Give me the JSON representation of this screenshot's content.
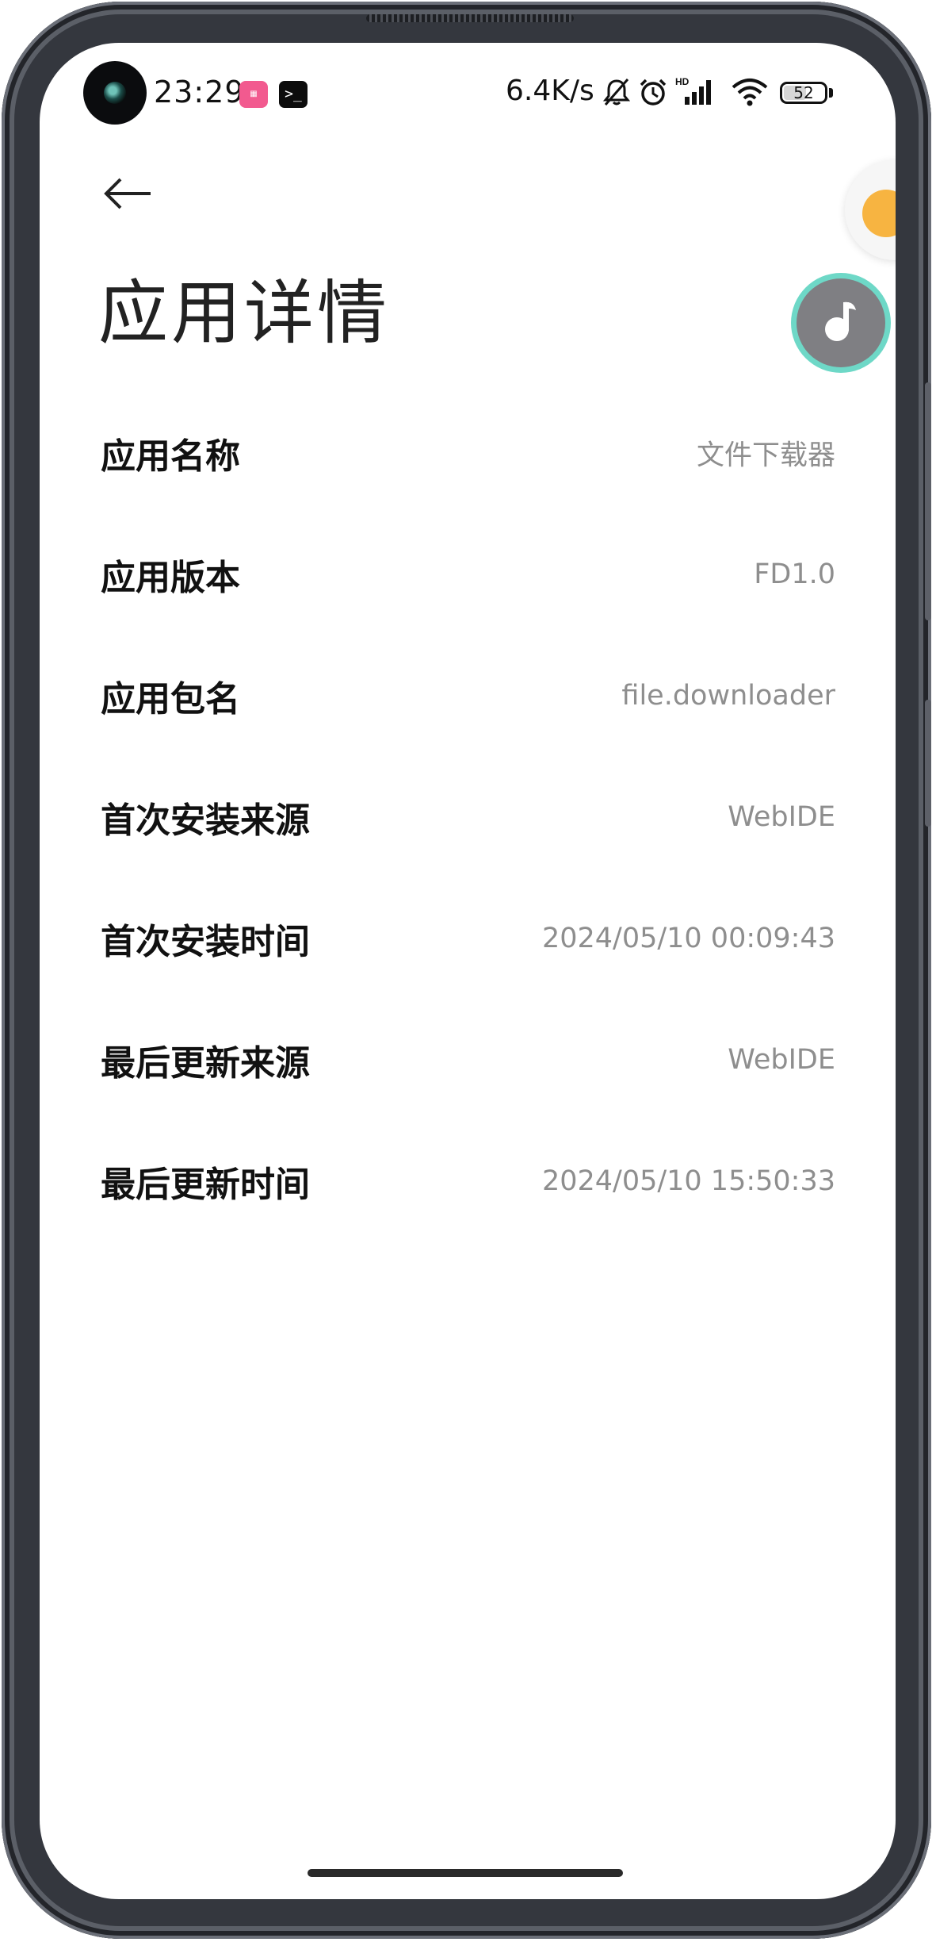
{
  "status_bar": {
    "time": "23:29",
    "net_speed": "6.4K/s",
    "battery": "52",
    "battery_level": 0.52,
    "icons": [
      "app-notification-icon",
      "terminal-icon",
      "mute-bell-icon",
      "alarm-icon",
      "hd-signal-icon",
      "wifi-icon",
      "battery-icon"
    ]
  },
  "header": {
    "back_icon": "back-arrow-icon",
    "title": "应用详情"
  },
  "floating": {
    "coin_icon": "coin-icon",
    "music_icon": "music-note-icon"
  },
  "details": [
    {
      "label": "应用名称",
      "value": "文件下载器"
    },
    {
      "label": "应用版本",
      "value": "FD1.0"
    },
    {
      "label": "应用包名",
      "value": "file.downloader"
    },
    {
      "label": "首次安装来源",
      "value": "WebIDE"
    },
    {
      "label": "首次安装时间",
      "value": "2024/05/10 00:09:43"
    },
    {
      "label": "最后更新来源",
      "value": "WebIDE"
    },
    {
      "label": "最后更新时间",
      "value": "2024/05/10 15:50:33"
    }
  ],
  "colors": {
    "label": "#111111",
    "value": "#8e8e8e",
    "accent_ring": "#6ed8c7",
    "coin": "#f7b441",
    "frame": "#34373e"
  }
}
